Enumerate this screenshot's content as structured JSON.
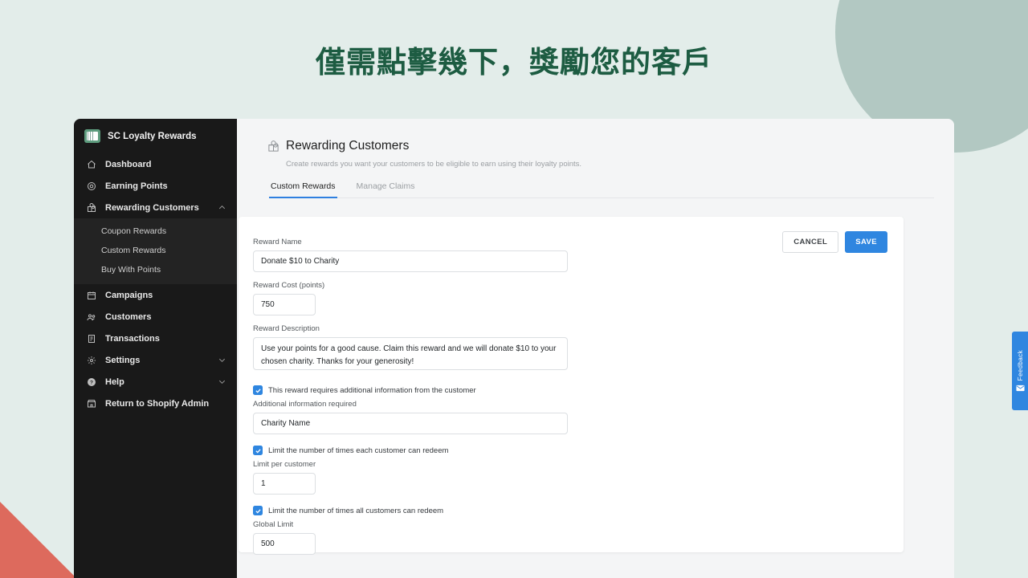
{
  "headline": "僅需點擊幾下，獎勵您的客戶",
  "colors": {
    "page_background": "#e3edea",
    "headline": "#1d5c42",
    "deco_circle": "#b2c8c2",
    "deco_triangle": "#dd6a5d",
    "sidebar": "#191919",
    "accent_blue": "#2f86e0",
    "logo_green": "#5e9c7e"
  },
  "sidebar": {
    "brand": {
      "name": "SC Loyalty Rewards",
      "logo_icon": "app-logo-icon"
    },
    "items": [
      {
        "label": "Dashboard",
        "icon": "home-icon",
        "chevron": null
      },
      {
        "label": "Earning Points",
        "icon": "target-icon",
        "chevron": null
      },
      {
        "label": "Rewarding Customers",
        "icon": "gift-icon",
        "chevron": "chevron-up-icon",
        "active": true
      },
      {
        "label": "Campaigns",
        "icon": "calendar-icon",
        "chevron": null
      },
      {
        "label": "Customers",
        "icon": "people-icon",
        "chevron": null
      },
      {
        "label": "Transactions",
        "icon": "receipt-icon",
        "chevron": null
      },
      {
        "label": "Settings",
        "icon": "gear-icon",
        "chevron": "chevron-down-icon"
      },
      {
        "label": "Help",
        "icon": "help-circle-icon",
        "chevron": "chevron-down-icon"
      },
      {
        "label": "Return to Shopify Admin",
        "icon": "storefront-icon",
        "chevron": null
      }
    ],
    "submenu": [
      {
        "label": "Coupon Rewards"
      },
      {
        "label": "Custom Rewards"
      },
      {
        "label": "Buy With Points"
      }
    ]
  },
  "main": {
    "page_title": "Rewarding Customers",
    "page_title_icon": "gift-icon",
    "page_subtitle": "Create rewards you want your customers to be eligible to earn using their loyalty points.",
    "tabs": [
      {
        "label": "Custom Rewards",
        "active": true
      },
      {
        "label": "Manage Claims",
        "active": false
      }
    ],
    "actions": {
      "cancel_label": "CANCEL",
      "save_label": "SAVE"
    },
    "form": {
      "reward_name": {
        "label": "Reward Name",
        "value": "Donate $10 to Charity",
        "placeholder": "Reward Name"
      },
      "reward_cost": {
        "label": "Reward Cost (points)",
        "value": "750",
        "placeholder": "0"
      },
      "reward_description": {
        "label": "Reward Description",
        "value": "Use your points for a good cause. Claim this reward and we will donate $10 to your chosen charity. Thanks for your generosity!",
        "placeholder": "Reward Description"
      },
      "requires_info": {
        "checkbox_label": "This reward requires additional information from the customer",
        "checked": true,
        "field_label": "Additional information required",
        "value": "Charity Name",
        "placeholder": "Additional information required"
      },
      "limit_per_customer": {
        "checkbox_label": "Limit the number of times each customer can redeem",
        "checked": true,
        "field_label": "Limit per customer",
        "value": "1",
        "placeholder": "0"
      },
      "global_limit": {
        "checkbox_label": "Limit the number of times all customers can redeem",
        "checked": true,
        "field_label": "Global Limit",
        "value": "500",
        "placeholder": "0"
      }
    }
  },
  "feedback": {
    "label": "Feedback",
    "icon": "envelope-icon"
  }
}
